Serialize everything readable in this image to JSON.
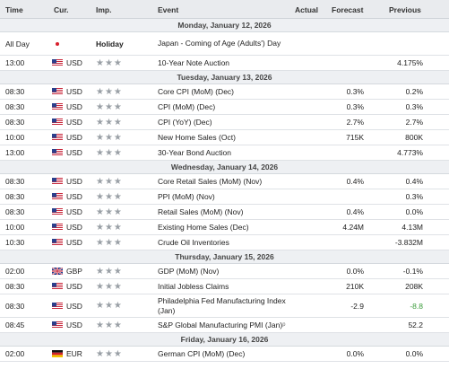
{
  "header": {
    "time": "Time",
    "currency": "Cur.",
    "importance": "Imp.",
    "event": "Event",
    "actual": "Actual",
    "forecast": "Forecast",
    "previous": "Previous"
  },
  "days": [
    {
      "label": "Monday, January 12, 2026",
      "events": [
        {
          "time": "All Day",
          "flag": "JP",
          "currency": "",
          "importance": "Holiday",
          "event": "Japan - Coming of Age (Adults') Day",
          "actual": "",
          "forecast": "",
          "previous": ""
        },
        {
          "time": "13:00",
          "flag": "US",
          "currency": "USD",
          "importance": "★★★",
          "event": "10-Year Note Auction",
          "actual": "",
          "forecast": "",
          "previous": "4.175%"
        }
      ]
    },
    {
      "label": "Tuesday, January 13, 2026",
      "events": [
        {
          "time": "08:30",
          "flag": "US",
          "currency": "USD",
          "importance": "★★★",
          "event": "Core CPI (MoM) (Dec)",
          "actual": "",
          "forecast": "0.3%",
          "previous": "0.2%"
        },
        {
          "time": "08:30",
          "flag": "US",
          "currency": "USD",
          "importance": "★★★",
          "event": "CPI (MoM) (Dec)",
          "actual": "",
          "forecast": "0.3%",
          "previous": "0.3%"
        },
        {
          "time": "08:30",
          "flag": "US",
          "currency": "USD",
          "importance": "★★★",
          "event": "CPI (YoY) (Dec)",
          "actual": "",
          "forecast": "2.7%",
          "previous": "2.7%"
        },
        {
          "time": "10:00",
          "flag": "US",
          "currency": "USD",
          "importance": "★★★",
          "event": "New Home Sales (Oct)",
          "actual": "",
          "forecast": "715K",
          "previous": "800K"
        },
        {
          "time": "13:00",
          "flag": "US",
          "currency": "USD",
          "importance": "★★★",
          "event": "30-Year Bond Auction",
          "actual": "",
          "forecast": "",
          "previous": "4.773%"
        }
      ]
    },
    {
      "label": "Wednesday, January 14, 2026",
      "events": [
        {
          "time": "08:30",
          "flag": "US",
          "currency": "USD",
          "importance": "★★★",
          "event": "Core Retail Sales (MoM) (Nov)",
          "actual": "",
          "forecast": "0.4%",
          "previous": "0.4%"
        },
        {
          "time": "08:30",
          "flag": "US",
          "currency": "USD",
          "importance": "★★★",
          "event": "PPI (MoM) (Nov)",
          "actual": "",
          "forecast": "",
          "previous": "0.3%"
        },
        {
          "time": "08:30",
          "flag": "US",
          "currency": "USD",
          "importance": "★★★",
          "event": "Retail Sales (MoM) (Nov)",
          "actual": "",
          "forecast": "0.4%",
          "previous": "0.0%"
        },
        {
          "time": "10:00",
          "flag": "US",
          "currency": "USD",
          "importance": "★★★",
          "event": "Existing Home Sales (Dec)",
          "actual": "",
          "forecast": "4.24M",
          "previous": "4.13M"
        },
        {
          "time": "10:30",
          "flag": "US",
          "currency": "USD",
          "importance": "★★★",
          "event": "Crude Oil Inventories",
          "actual": "",
          "forecast": "",
          "previous": "-3.832M"
        }
      ]
    },
    {
      "label": "Thursday, January 15, 2026",
      "events": [
        {
          "time": "02:00",
          "flag": "GB",
          "currency": "GBP",
          "importance": "★★★",
          "event": "GDP (MoM) (Nov)",
          "actual": "",
          "forecast": "0.0%",
          "previous": "-0.1%"
        },
        {
          "time": "08:30",
          "flag": "US",
          "currency": "USD",
          "importance": "★★★",
          "event": "Initial Jobless Claims",
          "actual": "",
          "forecast": "210K",
          "previous": "208K"
        },
        {
          "time": "08:30",
          "flag": "US",
          "currency": "USD",
          "importance": "★★★",
          "event": "Philadelphia Fed Manufacturing Index (Jan)",
          "actual": "",
          "forecast": "-2.9",
          "previous": "-8.8",
          "previous_color": "#3a9b3a"
        },
        {
          "time": "08:45",
          "flag": "US",
          "currency": "USD",
          "importance": "★★★",
          "event": "S&P Global Manufacturing PMI (Jan)",
          "event_icon": "ᵖ",
          "actual": "",
          "forecast": "",
          "previous": "52.2"
        }
      ]
    },
    {
      "label": "Friday, January 16, 2026",
      "events": [
        {
          "time": "02:00",
          "flag": "DE",
          "currency": "EUR",
          "importance": "★★★",
          "event": "German CPI (MoM) (Dec)",
          "actual": "",
          "forecast": "0.0%",
          "previous": "0.0%"
        }
      ]
    }
  ]
}
